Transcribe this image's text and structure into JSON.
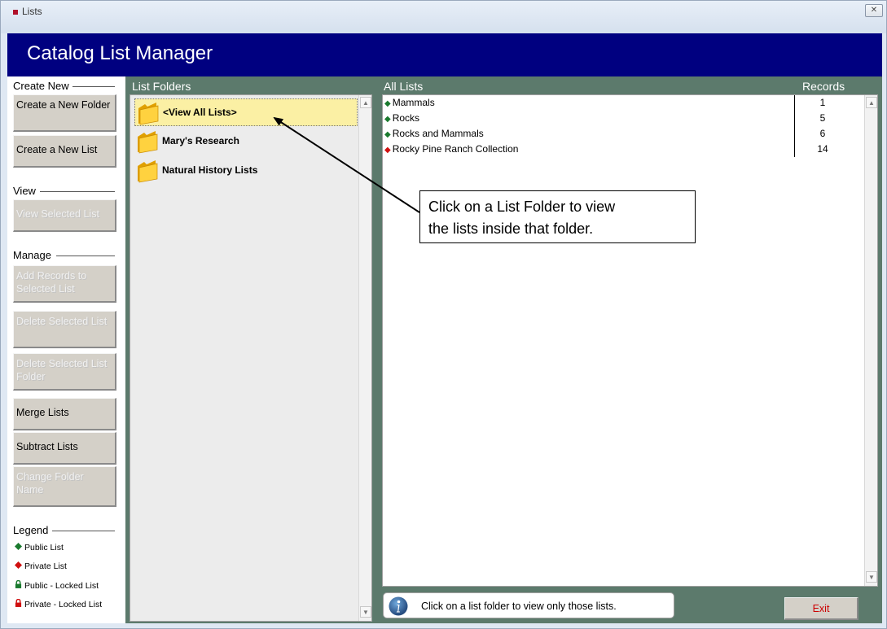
{
  "window": {
    "title": "Lists",
    "close_glyph": "✕",
    "header_title": "Catalog List Manager"
  },
  "sidebar": {
    "sections": {
      "create_new": "Create New",
      "view": "View",
      "manage": "Manage",
      "legend": "Legend"
    },
    "buttons": {
      "create_folder": "Create a New Folder",
      "create_list": "Create a New List",
      "view_selected": "View Selected List",
      "add_records": "Add Records to Selected List",
      "delete_list": "Delete Selected List",
      "delete_folder": "Delete Selected List Folder",
      "merge": "Merge Lists",
      "subtract": "Subtract Lists",
      "change_folder_name": "Change Folder Name"
    },
    "legend_items": [
      {
        "label": "Public List",
        "icon": "green-diamond",
        "color": "#1a7a2e"
      },
      {
        "label": "Private List",
        "icon": "red-diamond",
        "color": "#d01010"
      },
      {
        "label": "Public - Locked List",
        "icon": "green-lock",
        "color": "#1a7a2e"
      },
      {
        "label": "Private - Locked List",
        "icon": "red-lock",
        "color": "#d01010"
      }
    ]
  },
  "folders": {
    "heading": "List Folders",
    "items": [
      {
        "label": "<View All Lists>",
        "selected": true
      },
      {
        "label": "Mary's Research",
        "selected": false
      },
      {
        "label": "Natural History Lists",
        "selected": false
      }
    ]
  },
  "lists": {
    "heading": "All Lists",
    "records_heading": "Records",
    "rows": [
      {
        "name": "Mammals",
        "records": "1",
        "visibility": "public"
      },
      {
        "name": "Rocks",
        "records": "5",
        "visibility": "public"
      },
      {
        "name": "Rocks and Mammals",
        "records": "6",
        "visibility": "public"
      },
      {
        "name": "Rocky Pine Ranch Collection",
        "records": "14",
        "visibility": "private"
      }
    ]
  },
  "callout": {
    "line1": "Click on a List Folder to view",
    "line2": "the lists inside that folder."
  },
  "status": {
    "text": "Click on a list folder to view only those lists.",
    "icon": "info-icon"
  },
  "exit_label": "Exit",
  "colors": {
    "header_bg": "#000080",
    "panel_bg": "#5c7a6c",
    "selected_folder": "#fbf0a4",
    "public": "#1a7a2e",
    "private": "#d01010"
  }
}
